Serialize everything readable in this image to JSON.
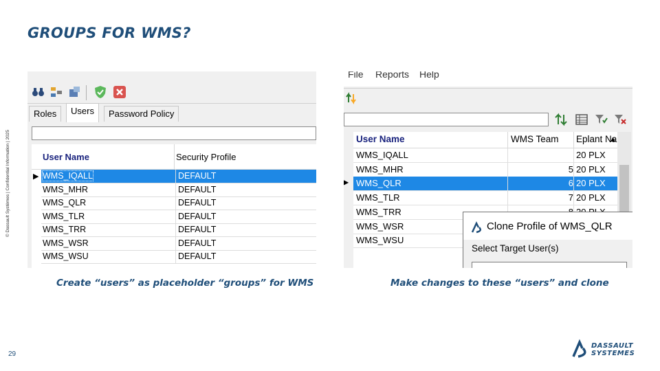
{
  "slide": {
    "title": "GROUPS FOR WMS?",
    "side_note": "© Dassault Systèmes | Confidential Information | 2025",
    "page_number": "29",
    "caption_left": "Create “users” as placeholder “groups” for WMS",
    "caption_right": "Make changes to these “users” and clone",
    "brand_line1": "DASSAULT",
    "brand_line2": "SYSTEMES",
    "brand_color": "#1f4e79"
  },
  "left_window": {
    "toolbar_icons": [
      "binoculars-icon",
      "grid-icon",
      "export-icon",
      "approve-shield-icon",
      "delete-icon"
    ],
    "tabs": [
      {
        "label": "Roles",
        "active": false
      },
      {
        "label": "Users",
        "active": true
      },
      {
        "label": "Password Policy",
        "active": false
      }
    ],
    "columns": [
      "User Name",
      "Security Profile"
    ],
    "rows": [
      {
        "user": "WMS_IQALL",
        "profile": "DEFAULT",
        "selected": true
      },
      {
        "user": "WMS_MHR",
        "profile": "DEFAULT",
        "selected": false
      },
      {
        "user": "WMS_QLR",
        "profile": "DEFAULT",
        "selected": false
      },
      {
        "user": "WMS_TLR",
        "profile": "DEFAULT",
        "selected": false
      },
      {
        "user": "WMS_TRR",
        "profile": "DEFAULT",
        "selected": false
      },
      {
        "user": "WMS_WSR",
        "profile": "DEFAULT",
        "selected": false
      },
      {
        "user": "WMS_WSU",
        "profile": "DEFAULT",
        "selected": false
      }
    ],
    "selection_color": "#1e88e5"
  },
  "right_window": {
    "menu": [
      "File",
      "Reports",
      "Help"
    ],
    "columns": [
      "User Name",
      "WMS Team",
      "Eplant Na"
    ],
    "rows": [
      {
        "user": "WMS_IQALL",
        "team": "",
        "eplant": "20 PLX",
        "selected": false
      },
      {
        "user": "WMS_MHR",
        "team": "5",
        "eplant": "20 PLX",
        "selected": false
      },
      {
        "user": "WMS_QLR",
        "team": "6",
        "eplant": "20 PLX",
        "selected": true
      },
      {
        "user": "WMS_TLR",
        "team": "7",
        "eplant": "20 PLX",
        "selected": false
      },
      {
        "user": "WMS_TRR",
        "team": "8",
        "eplant": "20 PLX",
        "selected": false
      },
      {
        "user": "WMS_WSR",
        "team": "",
        "eplant": "",
        "selected": false
      },
      {
        "user": "WMS_WSU",
        "team": "",
        "eplant": "",
        "selected": false
      }
    ],
    "dialog": {
      "title": "Clone Profile of  WMS_QLR",
      "label": "Select Target User(s)"
    }
  }
}
